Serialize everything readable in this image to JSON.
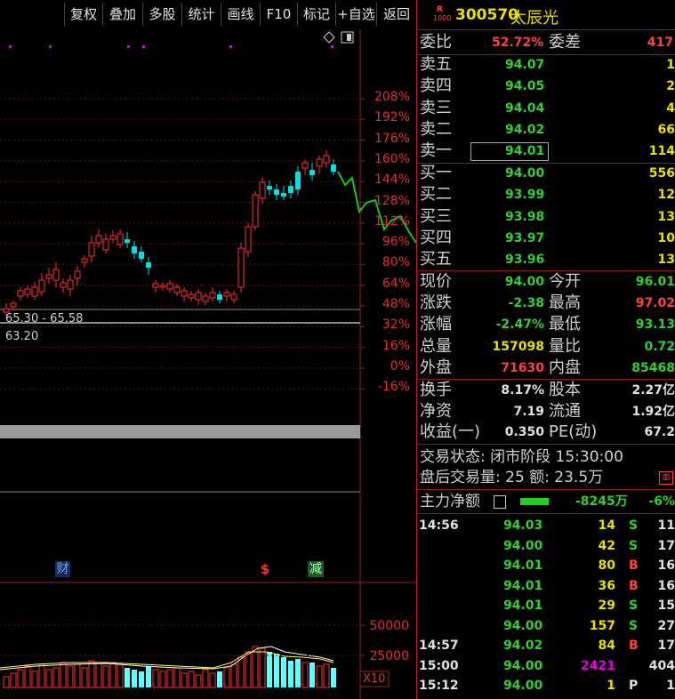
{
  "toolbar": {
    "buttons": [
      "复权",
      "叠加",
      "多股",
      "统计",
      "画线",
      "F10",
      "标记",
      "+自选",
      "返回"
    ]
  },
  "chart": {
    "pct_labels": [
      "208%",
      "192%",
      "176%",
      "160%",
      "144%",
      "128%",
      "112%",
      "96%",
      "80%",
      "64%",
      "48%",
      "32%",
      "16%",
      "0%",
      "-16%"
    ],
    "range_label": "65.30 - 65.58",
    "low_label": "63.20",
    "markers": {
      "cai": "财",
      "s": "$",
      "jian": "减"
    },
    "volume_labels": [
      "50000",
      "25000"
    ],
    "x10": "X10",
    "colors": {
      "up": "#ff3030",
      "down": "#00e0e0",
      "intraday": "#20c020",
      "ma": "#ffff60"
    }
  },
  "stock": {
    "badge_top": "R",
    "badge_bottom": "1000",
    "code": "300570",
    "name": "太辰光"
  },
  "weibi": {
    "label": "委比",
    "value": "52.72%",
    "diff_label": "委差",
    "diff_value": "417"
  },
  "asks": [
    {
      "label": "卖五",
      "price": "94.07",
      "vol": "1"
    },
    {
      "label": "卖四",
      "price": "94.05",
      "vol": "2"
    },
    {
      "label": "卖三",
      "price": "94.04",
      "vol": "4"
    },
    {
      "label": "卖二",
      "price": "94.02",
      "vol": "66"
    },
    {
      "label": "卖一",
      "price": "94.01",
      "vol": "114"
    }
  ],
  "bids": [
    {
      "label": "买一",
      "price": "94.00",
      "vol": "556"
    },
    {
      "label": "买二",
      "price": "93.99",
      "vol": "12"
    },
    {
      "label": "买三",
      "price": "93.98",
      "vol": "13"
    },
    {
      "label": "买四",
      "price": "93.97",
      "vol": "10"
    },
    {
      "label": "买五",
      "price": "93.96",
      "vol": "13"
    }
  ],
  "quote": [
    {
      "l1": "现价",
      "v1": "94.00",
      "l2": "今开",
      "v2": "96.01"
    },
    {
      "l1": "涨跌",
      "v1": "-2.38",
      "l2": "最高",
      "v2": "97.02"
    },
    {
      "l1": "涨幅",
      "v1": "-2.47%",
      "l2": "最低",
      "v2": "93.13"
    },
    {
      "l1": "总量",
      "v1": "157098",
      "l2": "量比",
      "v2": "0.72"
    },
    {
      "l1": "外盘",
      "v1": "71630",
      "l2": "内盘",
      "v2": "85468"
    }
  ],
  "fund": [
    {
      "l1": "换手",
      "v1": "8.17%",
      "l2": "股本",
      "v2": "2.27亿"
    },
    {
      "l1": "净资",
      "v1": "7.19",
      "l2": "流通",
      "v2": "1.92亿"
    },
    {
      "l1": "收益(一)",
      "v1": "0.350",
      "l2": "PE(动)",
      "v2": "67.2"
    }
  ],
  "status": {
    "line1": "交易状态: 闭市阶段 15:30:00",
    "line2": "盘后交易量: 25  额: 23.5万"
  },
  "main_force": {
    "label": "主力净额",
    "value": "-8245万",
    "pct": "-6%"
  },
  "ticks": [
    {
      "time": "14:56",
      "price": "94.03",
      "vol": "14",
      "side": "S",
      "n": "11"
    },
    {
      "time": "",
      "price": "94.00",
      "vol": "42",
      "side": "S",
      "n": "17"
    },
    {
      "time": "",
      "price": "94.01",
      "vol": "80",
      "side": "B",
      "n": "16"
    },
    {
      "time": "",
      "price": "94.01",
      "vol": "36",
      "side": "B",
      "n": "16"
    },
    {
      "time": "",
      "price": "94.01",
      "vol": "29",
      "side": "S",
      "n": "15"
    },
    {
      "time": "",
      "price": "94.00",
      "vol": "157",
      "side": "S",
      "n": "27"
    },
    {
      "time": "14:57",
      "price": "94.02",
      "vol": "84",
      "side": "B",
      "n": "17"
    },
    {
      "time": "15:00",
      "price": "94.00",
      "vol": "2421",
      "side": "",
      "n": "404"
    },
    {
      "time": "15:12",
      "price": "94.00",
      "vol": "1",
      "side": "P",
      "n": "1"
    }
  ]
}
